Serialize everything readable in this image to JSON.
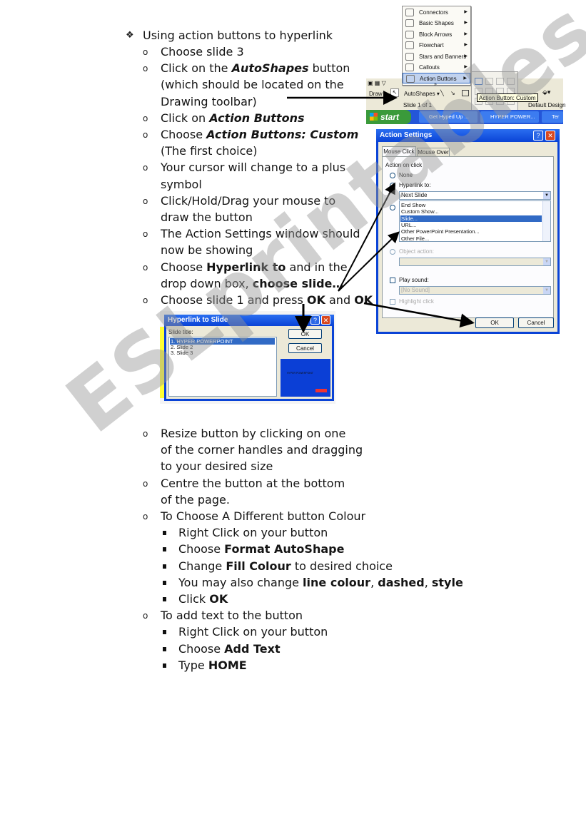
{
  "heading": {
    "bullet": "❖",
    "text": "Using action buttons to hyperlink"
  },
  "steps": [
    {
      "lines": [
        [
          {
            "t": "Choose slide 3"
          }
        ]
      ]
    },
    {
      "lines": [
        [
          {
            "t": "Click on the "
          },
          {
            "t": "AutoShapes",
            "b": true,
            "i": true
          },
          {
            "t": " button"
          }
        ],
        [
          {
            "t": "(which should be located on the"
          }
        ],
        [
          {
            "t": "Drawing toolbar)"
          }
        ]
      ]
    },
    {
      "lines": [
        [
          {
            "t": "Click on "
          },
          {
            "t": "Action Buttons",
            "b": true,
            "i": true
          }
        ]
      ]
    },
    {
      "lines": [
        [
          {
            "t": "Choose "
          },
          {
            "t": "Action Buttons: Custom",
            "b": true,
            "i": true
          }
        ],
        [
          {
            "t": "(The first choice)"
          }
        ]
      ]
    },
    {
      "lines": [
        [
          {
            "t": "Your cursor will change to a plus"
          }
        ],
        [
          {
            "t": "symbol"
          }
        ]
      ]
    },
    {
      "lines": [
        [
          {
            "t": "Click/Hold/Drag your mouse to"
          }
        ],
        [
          {
            "t": "draw the button"
          }
        ]
      ]
    },
    {
      "lines": [
        [
          {
            "t": "The Action Settings window should"
          }
        ],
        [
          {
            "t": "now be showing"
          }
        ]
      ]
    },
    {
      "lines": [
        [
          {
            "t": "Choose "
          },
          {
            "t": "Hyperlink to",
            "b": true
          },
          {
            "t": " and in the"
          }
        ],
        [
          {
            "t": "drop down box, "
          },
          {
            "t": "choose slide…",
            "b": true
          }
        ]
      ]
    },
    {
      "lines": [
        [
          {
            "t": "Choose slide 1 and press "
          },
          {
            "t": "OK",
            "b": true
          },
          {
            "t": " and "
          },
          {
            "t": "OK",
            "b": true
          }
        ]
      ]
    }
  ],
  "steps2": [
    {
      "lines": [
        [
          {
            "t": "Resize button by clicking on one"
          }
        ],
        [
          {
            "t": "of the corner handles and dragging"
          }
        ],
        [
          {
            "t": "to your desired size"
          }
        ]
      ]
    },
    {
      "lines": [
        [
          {
            "t": "Centre the button at the bottom"
          }
        ],
        [
          {
            "t": "of the page."
          }
        ]
      ]
    },
    {
      "lines": [
        [
          {
            "t": "To Choose A Different button Colour"
          }
        ]
      ],
      "sub": [
        [
          {
            "t": "Right Click on your button"
          }
        ],
        [
          {
            "t": "Choose "
          },
          {
            "t": "Format AutoShape",
            "b": true
          }
        ],
        [
          {
            "t": "Change "
          },
          {
            "t": "Fill Colour",
            "b": true
          },
          {
            "t": " to desired choice"
          }
        ],
        [
          {
            "t": "You may also change "
          },
          {
            "t": "line colour",
            "b": true
          },
          {
            "t": ", "
          },
          {
            "t": "dashed",
            "b": true
          },
          {
            "t": ", "
          },
          {
            "t": "style",
            "b": true
          }
        ],
        [
          {
            "t": "Click "
          },
          {
            "t": "OK",
            "b": true
          }
        ]
      ]
    },
    {
      "lines": [
        [
          {
            "t": "To add text to the button"
          }
        ]
      ],
      "sub": [
        [
          {
            "t": "Right Click on your button"
          }
        ],
        [
          {
            "t": "Choose "
          },
          {
            "t": "Add Text",
            "b": true
          }
        ],
        [
          {
            "t": "Type "
          },
          {
            "t": "HOME",
            "b": true
          }
        ]
      ]
    }
  ],
  "autoshapes_menu": {
    "items": [
      "Connectors",
      "Basic Shapes",
      "Block Arrows",
      "Flowchart",
      "Stars and Banners",
      "Callouts",
      "Action Buttons"
    ],
    "active_item": "Action Buttons",
    "more": "»"
  },
  "drawing_toolbar": {
    "draw_label": "Draw ▾",
    "autoshapes_label": "AutoShapes ▾",
    "status": "Slide 1 of 1",
    "design": "Default Design",
    "tooltip": "Action Button: Custom"
  },
  "taskbar": {
    "start": "start",
    "tasks": [
      "Get Hyped Up ...",
      "HYPER POWER...",
      "Ter"
    ]
  },
  "action_settings": {
    "title": "Action Settings",
    "tabs": [
      "Mouse Click",
      "Mouse Over"
    ],
    "group_label": "Action on click",
    "none_label": "None",
    "hyperlink_label": "Hyperlink to:",
    "hyperlink_value": "Next Slide",
    "dropdown_options": [
      "End Show",
      "Custom Show...",
      "Slide...",
      "URL...",
      "Other PowerPoint Presentation...",
      "Other File..."
    ],
    "selected_option": "Slide...",
    "object_action_label": "Object action:",
    "play_sound_label": "Play sound:",
    "sound_value": "[No Sound]",
    "highlight_label": "Highlight click",
    "ok": "OK",
    "cancel": "Cancel"
  },
  "hyperlink_to_slide": {
    "title": "Hyperlink to Slide",
    "slide_title_label": "Slide title:",
    "slides": [
      "1. HYPER POWERPOINT",
      "2. Slide 2",
      "3. Slide 3"
    ],
    "selected_slide": "1. HYPER POWERPOINT",
    "ok": "OK",
    "cancel": "Cancel",
    "preview_text": "HYPER POWERPOINT"
  },
  "watermark": "ESLprintables.com",
  "colors": {
    "xp_blue": "#0a43d6",
    "selection": "#316ac5",
    "dialog_bg": "#ece9d8",
    "preview_blue": "#0b3fd6"
  }
}
